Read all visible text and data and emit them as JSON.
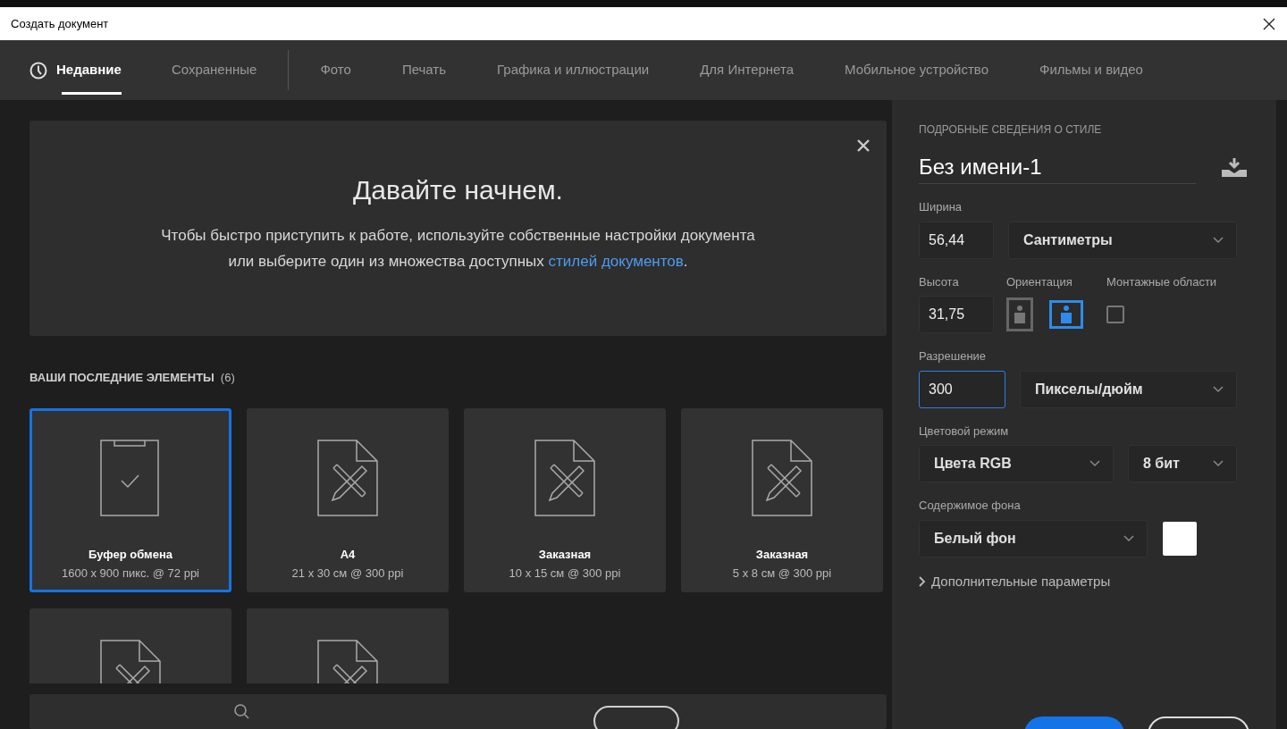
{
  "window": {
    "title": "Создать документ"
  },
  "tabs": {
    "primary": [
      {
        "label": "Недавние",
        "selected": true
      },
      {
        "label": "Сохраненные",
        "selected": false
      }
    ],
    "categories": [
      {
        "label": "Фото",
        "selected": false
      },
      {
        "label": "Печать",
        "selected": false
      },
      {
        "label": "Графика и иллюстрации",
        "selected": false
      },
      {
        "label": "Для Интернета",
        "selected": false
      },
      {
        "label": "Мобильное устройство",
        "selected": false
      },
      {
        "label": "Фильмы и видео",
        "selected": false
      }
    ]
  },
  "banner": {
    "heading": "Давайте начнем.",
    "body": "Чтобы быстро приступить к работе, используйте собственные настройки документа или выберите один из множества доступных",
    "link": "стилей документов",
    "end": "."
  },
  "recent": {
    "title": "ВАШИ ПОСЛЕДНИЕ ЭЛЕМЕНТЫ",
    "count": "(6)",
    "items": [
      {
        "kind": "clipboard",
        "name": "Буфер обмена",
        "details": "1600 x 900 пикс. @ 72 ppi",
        "selected": true
      },
      {
        "kind": "document",
        "name": "A4",
        "details": "21 x 30 см @ 300 ppi",
        "selected": false
      },
      {
        "kind": "document",
        "name": "Заказная",
        "details": "10 x 15 см @ 300 ppi",
        "selected": false
      },
      {
        "kind": "document",
        "name": "Заказная",
        "details": "5 x 8 см @ 300 ppi",
        "selected": false
      },
      {
        "kind": "document",
        "selected": false
      },
      {
        "kind": "document",
        "selected": false
      }
    ]
  },
  "details": {
    "section_title": "ПОДРОБНЫЕ СВЕДЕНИЯ О СТИЛЕ",
    "doc_name": "Без имени-1",
    "width": {
      "label": "Ширина",
      "value": "56,44",
      "unit": "Сантиметры"
    },
    "height": {
      "label": "Высота",
      "value": "31,75"
    },
    "orientation": {
      "label": "Ориентация",
      "options": [
        {
          "kind": "portrait",
          "selected": false
        },
        {
          "kind": "landscape",
          "selected": true
        }
      ]
    },
    "artboards": {
      "label": "Монтажные области",
      "checked": false
    },
    "resolution": {
      "label": "Разрешение",
      "value": "300",
      "unit": "Пикселы/дюйм",
      "focused": true
    },
    "color_mode": {
      "label": "Цветовой режим",
      "mode": "Цвета RGB",
      "depth": "8 бит"
    },
    "background": {
      "label": "Содержимое фона",
      "value": "Белый фон",
      "color": "#ffffff"
    },
    "advanced": {
      "label": "Дополнительные параметры",
      "expanded": false
    }
  }
}
